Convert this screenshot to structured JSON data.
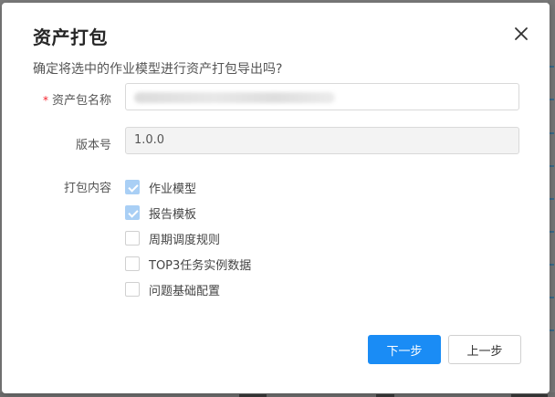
{
  "dialog": {
    "title": "资产打包",
    "confirm_text": "确定将选中的作业模型进行资产打包导出吗?"
  },
  "form": {
    "package_name": {
      "label": "资产包名称",
      "required_mark": "*",
      "value": ""
    },
    "version": {
      "label": "版本号",
      "value": "1.0.0"
    },
    "contents": {
      "label": "打包内容",
      "options": [
        {
          "label": "作业模型",
          "checked": true
        },
        {
          "label": "报告模板",
          "checked": true
        },
        {
          "label": "周期调度规则",
          "checked": false
        },
        {
          "label": "TOP3任务实例数据",
          "checked": false
        },
        {
          "label": "问题基础配置",
          "checked": false
        }
      ]
    }
  },
  "buttons": {
    "next": "下一步",
    "prev": "上一步"
  },
  "colors": {
    "primary": "#1a8cf5",
    "checked_box": "#a9cff5",
    "required": "#f5222d"
  }
}
